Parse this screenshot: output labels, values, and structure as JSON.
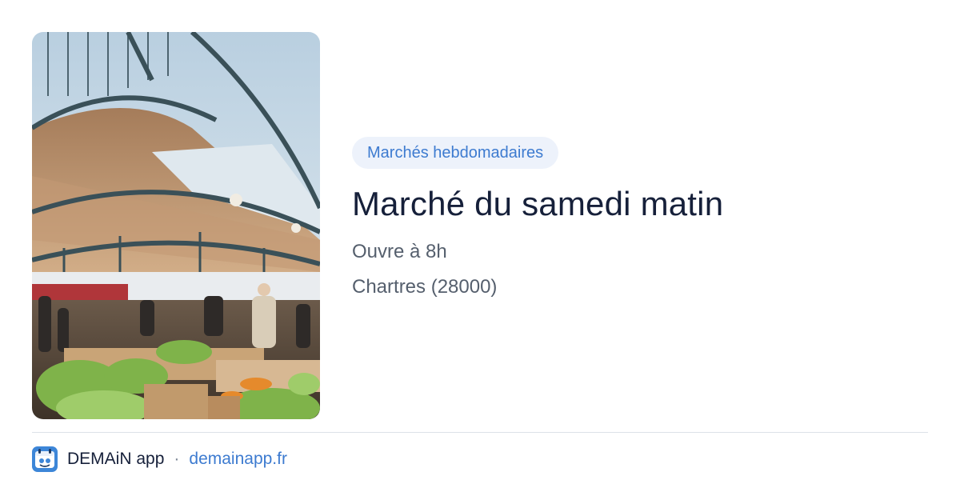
{
  "card": {
    "category": "Marchés hebdomadaires",
    "title": "Marché du samedi matin",
    "hours": "Ouvre à 8h",
    "location": "Chartres (28000)"
  },
  "footer": {
    "app_name": "DEMAiN app",
    "separator": "·",
    "domain": "demainapp.fr"
  },
  "colors": {
    "accent": "#3d7bd0",
    "badge_bg": "#edf2fb",
    "title": "#16203a",
    "body": "#555f6d"
  },
  "icons": {
    "app": "demain-app-logo-icon"
  }
}
